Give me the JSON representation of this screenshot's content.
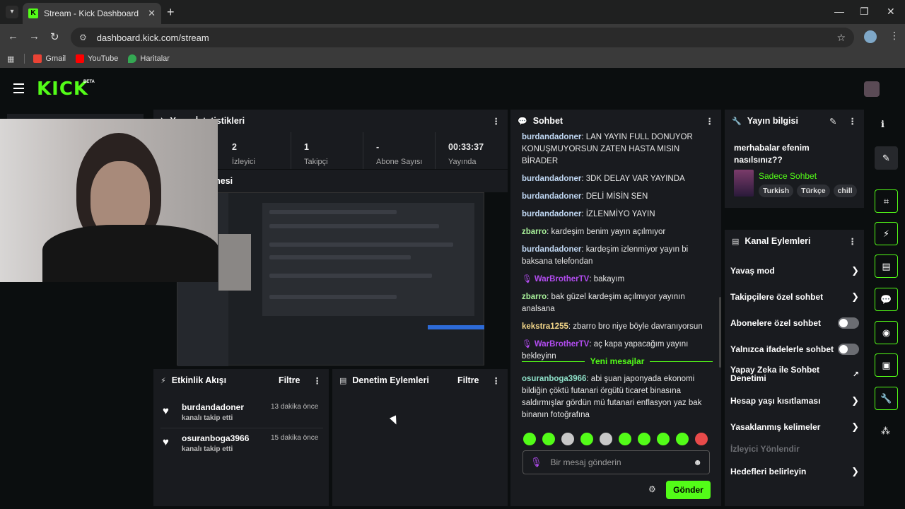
{
  "browser": {
    "tab_title": "Stream - Kick Dashboard",
    "url": "dashboard.kick.com/stream",
    "bookmarks": [
      {
        "label": "Gmail",
        "color": "#ea4335"
      },
      {
        "label": "YouTube",
        "color": "#ff0000"
      },
      {
        "label": "Haritalar",
        "color": "#34a853"
      }
    ]
  },
  "header": {
    "logo": "KICK",
    "beta": "BETA"
  },
  "stats_panel": {
    "title": "Yayın İstatistikleri",
    "items": [
      {
        "value": "2",
        "label": "İzleyici"
      },
      {
        "value": "1",
        "label": "Takipçi"
      },
      {
        "value": "-",
        "label": "Abone Sayısı"
      },
      {
        "value": "00:33:37",
        "label": "Yayında"
      }
    ]
  },
  "preview_panel": {
    "title": "Yayın Önizlemesi"
  },
  "activity_panel": {
    "title": "Etkinlik Akışı",
    "filter": "Filtre",
    "items": [
      {
        "name": "burdandadoner",
        "time": "13 dakika önce",
        "action": "kanalı takip etti"
      },
      {
        "name": "osuranboga3966",
        "time": "15 dakika önce",
        "action": "kanalı takip etti"
      }
    ]
  },
  "moderation_panel": {
    "title": "Denetim Eylemleri",
    "filter": "Filtre"
  },
  "chat": {
    "title": "Sohbet",
    "messages": [
      {
        "user": "burdandadoner",
        "color": "#c1d9f5",
        "text": "LAN YAYIN FULL DONUYOR KONUŞMUYORSUN ZATEN HASTA MISIN BİRADER"
      },
      {
        "user": "burdandadoner",
        "color": "#c1d9f5",
        "text": "3DK DELAY VAR YAYINDA"
      },
      {
        "user": "burdandadoner",
        "color": "#c1d9f5",
        "text": "DELİ MİSİN SEN"
      },
      {
        "user": "burdandadoner",
        "color": "#c1d9f5",
        "text": "İZLENMİYO YAYIN"
      },
      {
        "user": "zbarro",
        "color": "#a8f09a",
        "text": "kardeşim benim yayın açılmıyor"
      },
      {
        "user": "burdandadoner",
        "color": "#c1d9f5",
        "text": "kardeşim izlenmiyor yayın bi baksana telefondan"
      },
      {
        "user": "WarBrotherTV",
        "color": "#b24cf0",
        "text": "bakayım"
      },
      {
        "user": "zbarro",
        "color": "#a8f09a",
        "text": "bak güzel kardeşim açılmıyor yayının analsana"
      },
      {
        "user": "kekstra1255",
        "color": "#f5d88a",
        "text": "zbarro bro niye böyle davranıyorsun"
      },
      {
        "user": "WarBrotherTV",
        "color": "#b24cf0",
        "text": "aç kapa yapacağım yayını bekleyinn"
      }
    ],
    "new_messages_label": "Yeni mesajlar",
    "new_message": {
      "user": "osuranboga3966",
      "color": "#8ee0c8",
      "text": "abi şuan japonyada ekonomi bildiğin çöktü futanari örgütü ticaret binasına saldırmışlar gördün mü futanari enflasyon yaz bak binanın fotoğrafına"
    },
    "input_placeholder": "Bir mesaj gönderin",
    "send_label": "Gönder"
  },
  "stream_info": {
    "title": "Yayın bilgisi",
    "stream_title": "merhabalar efenim nasılsınız??",
    "category": "Sadece Sohbet",
    "tags": [
      "Turkish",
      "Türkçe",
      "chill"
    ]
  },
  "channel_actions": {
    "title": "Kanal Eylemleri",
    "items": [
      {
        "label": "Yavaş mod",
        "type": "link"
      },
      {
        "label": "Takipçilere özel sohbet",
        "type": "link"
      },
      {
        "label": "Abonelere özel sohbet",
        "type": "toggle"
      },
      {
        "label": "Yalnızca ifadelerle sohbet",
        "type": "toggle"
      },
      {
        "label": "Yapay Zeka ile Sohbet Denetimi",
        "type": "external"
      },
      {
        "label": "Hesap yaşı kısıtlaması",
        "type": "link"
      },
      {
        "label": "Yasaklanmış kelimeler",
        "type": "link"
      },
      {
        "label": "İzleyici Yönlendir",
        "type": "disabled"
      },
      {
        "label": "Hedefleri belirleyin",
        "type": "link"
      }
    ]
  },
  "colors": {
    "accent": "#53fc18",
    "panel": "#191b1f",
    "background": "#0b0e0f"
  }
}
